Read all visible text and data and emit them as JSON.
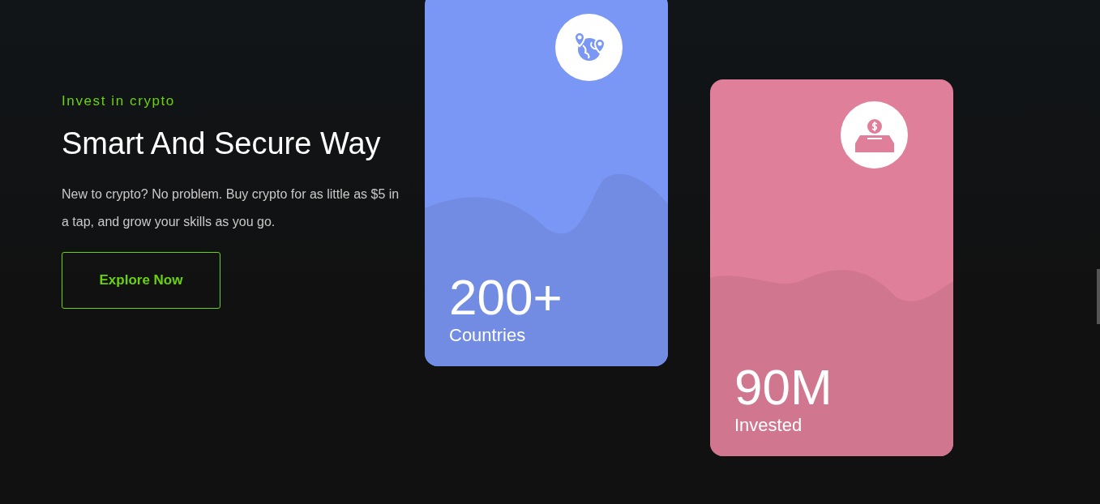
{
  "hero": {
    "eyebrow": "Invest in crypto",
    "title": "Smart And Secure Way",
    "description": "New to crypto? No problem. Buy crypto for as little as $5 in a tap, and grow your skills as you go.",
    "button": "Explore Now"
  },
  "stats": [
    {
      "kind": "globe",
      "value": "200+",
      "label": "Countries",
      "color": "#7b97f5"
    },
    {
      "kind": "deposit",
      "value": "90M",
      "label": "Invested",
      "color": "#e07f9a"
    }
  ]
}
